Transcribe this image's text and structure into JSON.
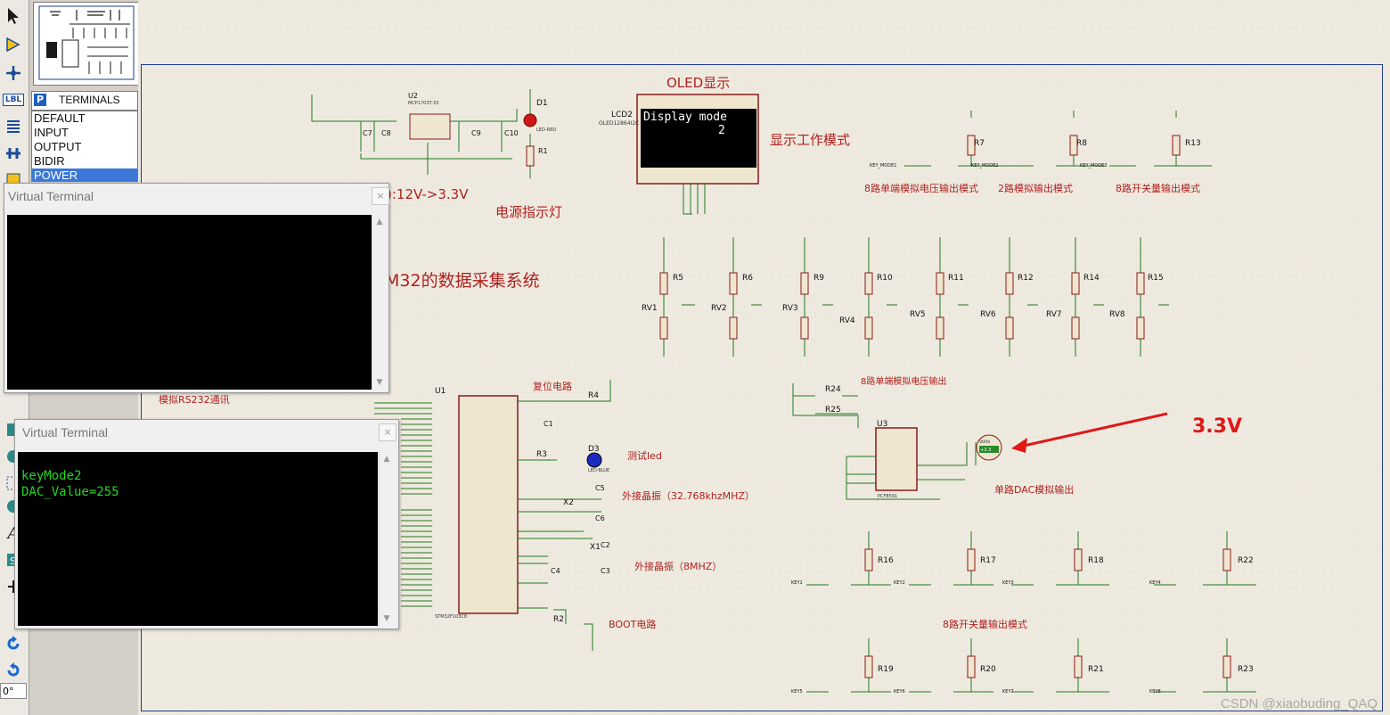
{
  "toolbar": {
    "tools": [
      "selection-tool",
      "component-tool",
      "junction-tool",
      "label-tool",
      "text-script-tool",
      "bus-tool",
      "subcircuit-tool"
    ],
    "lbl_text": "LBL",
    "rotation_value": "0°"
  },
  "terminals": {
    "badge": "P",
    "title": "TERMINALS",
    "items": [
      "DEFAULT",
      "INPUT",
      "OUTPUT",
      "BIDIR",
      "POWER"
    ],
    "selected": "POWER"
  },
  "terminal1": {
    "title": "Virtual Terminal",
    "close": "×",
    "content": ""
  },
  "terminal2": {
    "title": "Virtual Terminal",
    "close": "×",
    "lines": [
      "keyMode2",
      "DAC_Value=255"
    ]
  },
  "schematic": {
    "oled_title": "OLED显示",
    "lcd_ref": "LCD2",
    "lcd_part": "OLED12864I2C",
    "lcd_line1": "Display mode",
    "lcd_line2": "2",
    "work_mode": "显示工作模式",
    "power_text": "):12V->3.3V",
    "power_led": "电源指示灯",
    "system_title": "M32的数据采集系统",
    "rs232": "模拟RS232通讯",
    "reset": "复位电路",
    "test_led": "测试led",
    "osc1": "外接晶振（32.768khzMHZ）",
    "osc2": "外接晶振（8MHZ）",
    "boot": "BOOT电路",
    "analog8": "8路单端模拟电压输出",
    "dac": "单路DAC模拟输出",
    "switch8": "8路开关量输出模式",
    "mode1": "8路单端模拟电压输出模式",
    "mode2": "2路模拟输出模式",
    "mode3": "8路开关量输出模式",
    "volt": "3.3V",
    "u2_ref": "U2",
    "u2_part": "MCP1703T-33",
    "u1_ref": "U1",
    "u1_part": "STM32F103C8",
    "u3_ref": "U3",
    "u3_part": "PCF8591",
    "d1": "D1",
    "d3": "D3",
    "led_red": "LED-RED",
    "led_blue": "LED-BLUE",
    "x1": "X1",
    "x2": "X2",
    "pot_labels": [
      "RV1",
      "RV2",
      "RV3",
      "RV4",
      "RV5",
      "RV6",
      "RV7",
      "RV8"
    ],
    "res_top": [
      "R5",
      "R6",
      "R9",
      "R10",
      "R11",
      "R12",
      "R14",
      "R15"
    ],
    "key_mode_res": [
      "R7",
      "R8",
      "R13"
    ],
    "key_res_row1": [
      "R16",
      "R17",
      "R18",
      "R22"
    ],
    "key_res_row2": [
      "R19",
      "R20",
      "R21",
      "R23"
    ],
    "keys_row1": [
      "KEY1",
      "KEY2",
      "KEY3",
      "KEY4"
    ],
    "keys_row2": [
      "KEY5",
      "KEY6",
      "KEY7",
      "KEY8"
    ],
    "key_modes": [
      "KEY_MODE1",
      "KEY_MODE2",
      "KEY_MODE3"
    ],
    "cap_labels": [
      "C7",
      "C8",
      "C9",
      "C10"
    ],
    "r24": "R24",
    "r25": "R25",
    "r4": "R4",
    "r3": "R3",
    "r2": "R2",
    "r1": "R1",
    "c1": "C1",
    "c2": "C2",
    "c3": "C3",
    "c4": "C4",
    "c5": "C5",
    "c6": "C6",
    "volts_meter": "Volts",
    "volts_value": "+3.3"
  },
  "watermark": "CSDN @xiaobuding_QAQ",
  "colors": {
    "wire": "#1d7a1d",
    "component": "#8a1a1a",
    "accent": "#b0201e",
    "arrow": "#e01818",
    "sheet_border": "#1a3a8a"
  }
}
